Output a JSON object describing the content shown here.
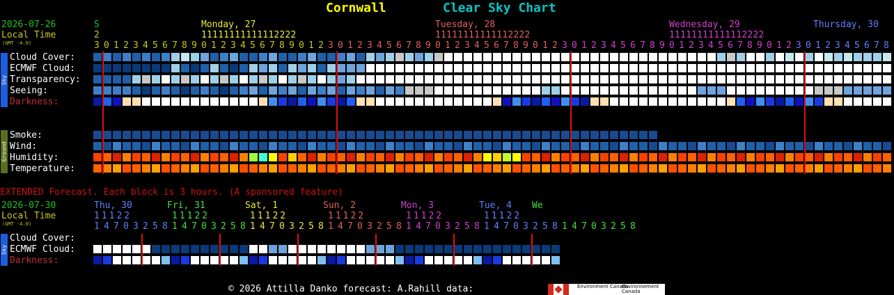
{
  "header": {
    "location": "Cornwall",
    "chart_name": "Clear Sky Chart"
  },
  "colors": {
    "bg": "#000000",
    "title_yellow": "#ffff00",
    "title_cyan": "#00c8c8",
    "date_green": "#20c020",
    "local_time": "#c8c820",
    "sky_sidebar": "#1a5fe0",
    "ground_sidebar": "#5a6e1a",
    "hour_line": "#e01010",
    "extended_red": "#d01010",
    "darkness_label": "#c03030",
    "cc_dark": "#0a3a78",
    "cc_mid": "#2060a8",
    "cc_lt1": "#3f7fc8",
    "cc_lt2": "#6fa3dc",
    "cc_lt3": "#9fd0e8",
    "cc_lt4": "#c8e8f0",
    "cc_grey": "#c8c8c8",
    "cc_white": "#ffffff"
  },
  "main": {
    "date": "2026-07-26",
    "date_suffix": "S",
    "date_hour": "2",
    "local_time_label": "Local Time",
    "gmt_offset": "(GMT -4.0)",
    "days": [
      {
        "label": "Monday, 27",
        "color": "#e8e840"
      },
      {
        "label": "Tuesday, 28",
        "color": "#e06060"
      },
      {
        "label": "Wednesday, 29",
        "color": "#d040d0"
      },
      {
        "label": "Thursday, 30",
        "color": "#6080ff"
      }
    ],
    "hour_digits_top": "11111111111112222",
    "hour_digits": "3012345678901234567890123012345678901234567890123012345678901234567890123012345678",
    "sidebar_sky": "Sky",
    "sidebar_ground": "Ground",
    "rows": {
      "cloud_cover": "Cloud Cover:",
      "ecmwf": "ECMWF Cloud:",
      "transparency": "Transparency:",
      "seeing": "Seeing:",
      "darkness": "Darkness:",
      "smoke": "Smoke:",
      "wind": "Wind:",
      "humidity": "Humidity:",
      "temperature": "Temperature:"
    }
  },
  "extended": {
    "note": "EXTENDED Forecast. Each block is 3 hours. (A sponsored feature)",
    "date": "2026-07-30",
    "local_time_label": "Local Time",
    "gmt_offset": "(GMT -4.0)",
    "days": [
      {
        "label": "Thu, 30",
        "color": "#6080ff"
      },
      {
        "label": "Fri, 31",
        "color": "#40e040"
      },
      {
        "label": "Sat, 1",
        "color": "#e8e840"
      },
      {
        "label": "Sun, 2",
        "color": "#e06060"
      },
      {
        "label": "Mon, 3",
        "color": "#d040d0"
      },
      {
        "label": "Tue, 4",
        "color": "#6080ff"
      },
      {
        "label": "We",
        "color": "#40e040"
      }
    ],
    "tens": [
      "11122",
      "11122",
      "11122",
      "11122",
      "11122",
      "11122"
    ],
    "hours": "14703258147032581470325814703258147032581470325814703258",
    "rows": {
      "cloud_cover": "Cloud Cover:",
      "ecmwf": "ECMWF Cloud:",
      "darkness": "Darkness:"
    }
  },
  "footer": {
    "text": "© 2026 Attilla Danko  forecast: A.Rahill  data:",
    "logo_en": "Environment Canada",
    "logo_fr": "Environnement Canada"
  }
}
